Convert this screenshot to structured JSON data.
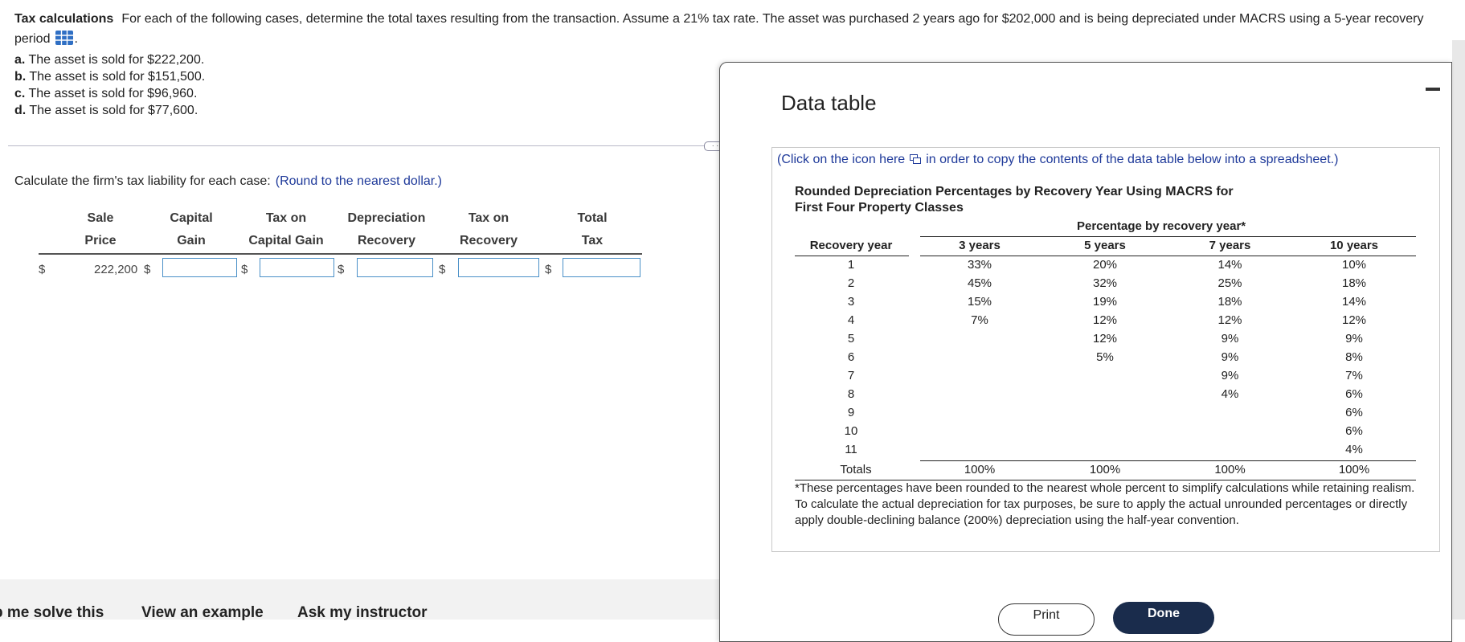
{
  "question": {
    "label": "Tax calculations",
    "text": "For each of the following cases, determine the total taxes resulting from the transaction. Assume a 21% tax rate. The asset was purchased 2 years ago for $202,000 and is being depreciated under MACRS using a 5-year recovery",
    "text2": "period",
    "icon": "data-table-grid-icon",
    "cases": [
      {
        "letter": "a.",
        "text": "The asset is sold for $222,200."
      },
      {
        "letter": "b.",
        "text": "The asset is sold for $151,500."
      },
      {
        "letter": "c.",
        "text": "The asset is sold for $96,960."
      },
      {
        "letter": "d.",
        "text": "The asset is sold for $77,600."
      }
    ]
  },
  "calc": {
    "prompt": "Calculate the firm's tax liability for each case:",
    "hint": "(Round to the nearest dollar.)",
    "headers": [
      {
        "line1": "Sale",
        "line2": "Price"
      },
      {
        "line1": "Capital",
        "line2": "Gain"
      },
      {
        "line1": "Tax on",
        "line2": "Capital Gain"
      },
      {
        "line1": "Depreciation",
        "line2": "Recovery"
      },
      {
        "line1": "Tax on",
        "line2": "Recovery"
      },
      {
        "line1": "Total",
        "line2": "Tax"
      }
    ],
    "row": {
      "currency": "$",
      "sale_price": "222,200",
      "inputs": [
        "",
        "",
        "",
        "",
        ""
      ]
    }
  },
  "bottom": {
    "links": [
      "p me solve this",
      "View an example",
      "Ask my instructor"
    ]
  },
  "modal": {
    "title": "Data table",
    "copy_text_pre": "(Click on the icon here",
    "copy_text_post": "in order to copy the contents of the data table below into a spreadsheet.)",
    "table_title_1": "Rounded Depreciation Percentages by Recovery Year Using MACRS for",
    "table_title_2": "First Four Property Classes",
    "pct_header": "Percentage by recovery year*",
    "columns": [
      "Recovery year",
      "3 years",
      "5 years",
      "7 years",
      "10 years"
    ],
    "rows": [
      [
        "1",
        "33%",
        "20%",
        "14%",
        "10%"
      ],
      [
        "2",
        "45%",
        "32%",
        "25%",
        "18%"
      ],
      [
        "3",
        "15%",
        "19%",
        "18%",
        "14%"
      ],
      [
        "4",
        "7%",
        "12%",
        "12%",
        "12%"
      ],
      [
        "5",
        "",
        "12%",
        "9%",
        "9%"
      ],
      [
        "6",
        "",
        "5%",
        "9%",
        "8%"
      ],
      [
        "7",
        "",
        "",
        "9%",
        "7%"
      ],
      [
        "8",
        "",
        "",
        "4%",
        "6%"
      ],
      [
        "9",
        "",
        "",
        "",
        "6%"
      ],
      [
        "10",
        "",
        "",
        "",
        "6%"
      ],
      [
        "11",
        "",
        "",
        "",
        "4%"
      ]
    ],
    "totals": [
      "Totals",
      "100%",
      "100%",
      "100%",
      "100%"
    ],
    "footnote": "*These percentages have been rounded to the nearest whole percent to simplify calculations while retaining realism. To calculate the actual depreciation for tax purposes, be sure to apply the actual unrounded percentages or directly apply double-declining balance (200%) depreciation using the half-year convention.",
    "print_label": "Print",
    "done_label": "Done"
  }
}
